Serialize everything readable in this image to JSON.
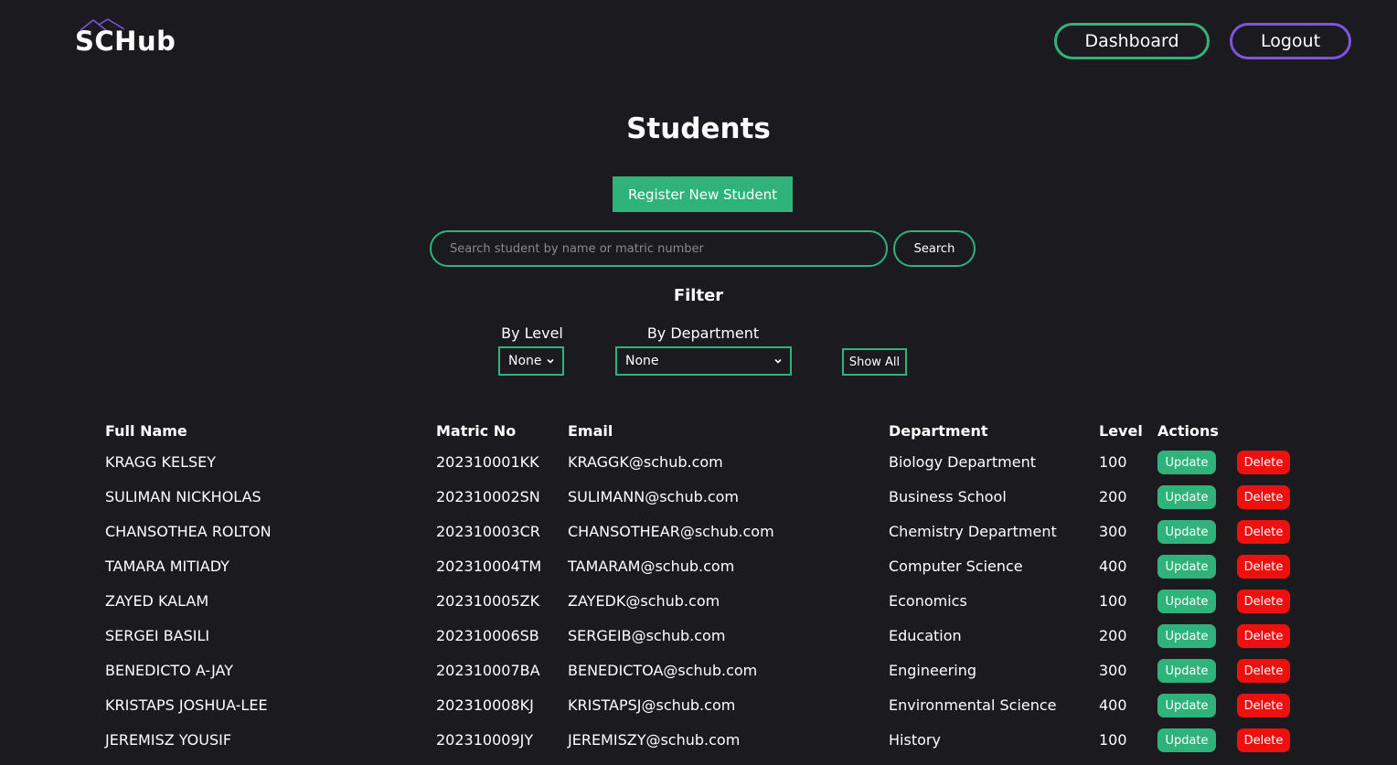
{
  "header": {
    "logo_text": "SCHub",
    "dashboard_label": "Dashboard",
    "logout_label": "Logout",
    "colors": {
      "accent_green": "#2fb37a",
      "accent_purple": "#7b55e0",
      "danger": "#ee0f0f",
      "background": "#1b1a1f"
    }
  },
  "page": {
    "title": "Students",
    "register_label": "Register New Student"
  },
  "search": {
    "placeholder": "Search student by name or matric number",
    "value": "",
    "button_label": "Search"
  },
  "filter": {
    "title": "Filter",
    "level_label": "By Level",
    "level_value": "None",
    "department_label": "By Department",
    "department_value": "None",
    "show_all_label": "Show All"
  },
  "table": {
    "headers": {
      "full_name": "Full Name",
      "matric_no": "Matric No",
      "email": "Email",
      "department": "Department",
      "level": "Level",
      "actions": "Actions"
    },
    "update_label": "Update",
    "delete_label": "Delete",
    "rows": [
      {
        "name": "KRAGG KELSEY",
        "matric": "202310001KK",
        "email": "KRAGGK@schub.com",
        "department": "Biology Department",
        "level": "100"
      },
      {
        "name": "SULIMAN NICKHOLAS",
        "matric": "202310002SN",
        "email": "SULIMANN@schub.com",
        "department": "Business School",
        "level": "200"
      },
      {
        "name": "CHANSOTHEA ROLTON",
        "matric": "202310003CR",
        "email": "CHANSOTHEAR@schub.com",
        "department": "Chemistry Department",
        "level": "300"
      },
      {
        "name": "TAMARA MITIADY",
        "matric": "202310004TM",
        "email": "TAMARAM@schub.com",
        "department": "Computer Science",
        "level": "400"
      },
      {
        "name": "ZAYED KALAM",
        "matric": "202310005ZK",
        "email": "ZAYEDK@schub.com",
        "department": "Economics",
        "level": "100"
      },
      {
        "name": "SERGEI BASILI",
        "matric": "202310006SB",
        "email": "SERGEIB@schub.com",
        "department": "Education",
        "level": "200"
      },
      {
        "name": "BENEDICTO A-JAY",
        "matric": "202310007BA",
        "email": "BENEDICTOA@schub.com",
        "department": "Engineering",
        "level": "300"
      },
      {
        "name": "KRISTAPS JOSHUA-LEE",
        "matric": "202310008KJ",
        "email": "KRISTAPSJ@schub.com",
        "department": "Environmental Science",
        "level": "400"
      },
      {
        "name": "JEREMISZ YOUSIF",
        "matric": "202310009JY",
        "email": "JEREMISZY@schub.com",
        "department": "History",
        "level": "100"
      }
    ]
  }
}
